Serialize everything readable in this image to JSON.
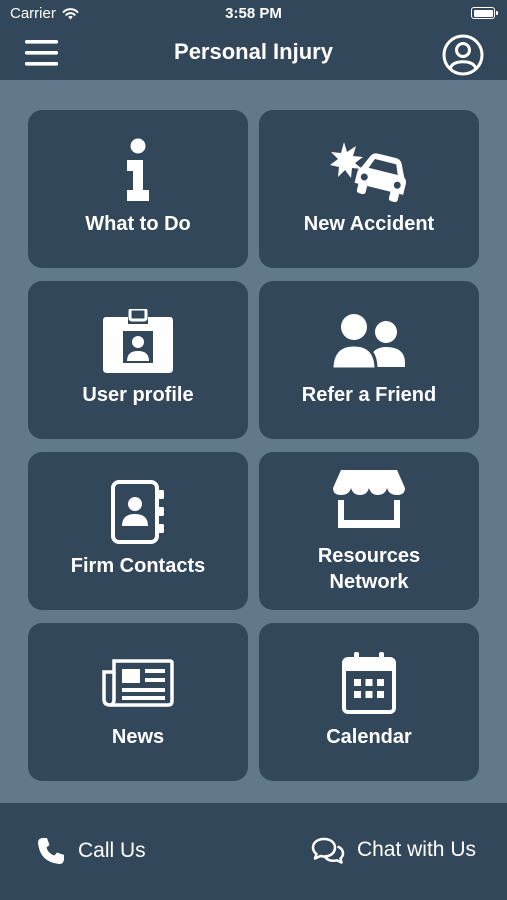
{
  "status_bar": {
    "carrier": "Carrier",
    "time": "3:58 PM"
  },
  "header": {
    "title": "Personal Injury",
    "menu_icon": "hamburger-menu-icon",
    "profile_icon": "user-circle-icon"
  },
  "tiles": [
    {
      "label": "What to Do",
      "icon": "info-icon"
    },
    {
      "label": "New Accident",
      "icon": "car-crash-icon"
    },
    {
      "label": "User profile",
      "icon": "id-badge-icon"
    },
    {
      "label": "Refer a Friend",
      "icon": "users-icon"
    },
    {
      "label": "Firm Contacts",
      "icon": "address-book-icon"
    },
    {
      "label": "Resources\nNetwork",
      "icon": "store-icon"
    },
    {
      "label": "News",
      "icon": "newspaper-icon"
    },
    {
      "label": "Calendar",
      "icon": "calendar-icon"
    }
  ],
  "footer": {
    "call_label": "Call Us",
    "call_icon": "phone-icon",
    "chat_label": "Chat with Us",
    "chat_icon": "chat-bubbles-icon"
  },
  "colors": {
    "background": "#62788b",
    "tile": "#33475a",
    "bars": "#33475a",
    "text": "#ffffff"
  }
}
